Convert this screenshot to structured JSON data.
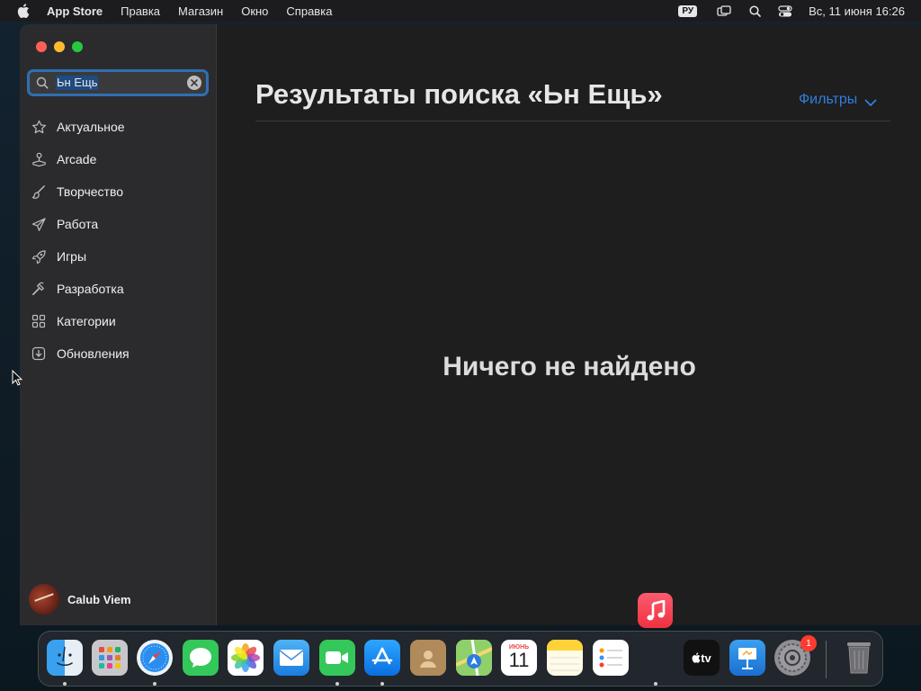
{
  "menubar": {
    "app_name": "App Store",
    "items": [
      "Правка",
      "Магазин",
      "Окно",
      "Справка"
    ],
    "input_source": "РУ",
    "clock": "Вс, 11 июня  16:26"
  },
  "sidebar": {
    "search_value": "Ьн Ещь",
    "items": [
      {
        "label": "Актуальное",
        "icon": "star-icon"
      },
      {
        "label": "Arcade",
        "icon": "joystick-icon"
      },
      {
        "label": "Творчество",
        "icon": "brush-icon"
      },
      {
        "label": "Работа",
        "icon": "paperplane-icon"
      },
      {
        "label": "Игры",
        "icon": "rocket-icon"
      },
      {
        "label": "Разработка",
        "icon": "hammer-icon"
      },
      {
        "label": "Категории",
        "icon": "grid-icon"
      },
      {
        "label": "Обновления",
        "icon": "download-icon"
      }
    ],
    "user_name": "Calub Viem"
  },
  "main": {
    "title": "Результаты поиска «Ьн Ещь»",
    "filters_label": "Фильтры",
    "empty_message": "Ничего не найдено"
  },
  "dock": {
    "apps": [
      "finder",
      "launchpad",
      "safari",
      "messages",
      "photos",
      "mail",
      "facetime",
      "app-store",
      "contacts",
      "maps",
      "calendar",
      "notes",
      "reminders",
      "apple-tv",
      "keynote",
      "system-settings",
      "trash"
    ],
    "calendar_month": "ИЮНЬ",
    "calendar_day": "11",
    "tv_label": "tv",
    "settings_badge": "1"
  },
  "colors": {
    "accent": "#2f7fe0",
    "menubar_bg": "#1c1c1e",
    "sidebar_bg": "#2b2b2d",
    "main_bg": "#1e1e1e"
  }
}
